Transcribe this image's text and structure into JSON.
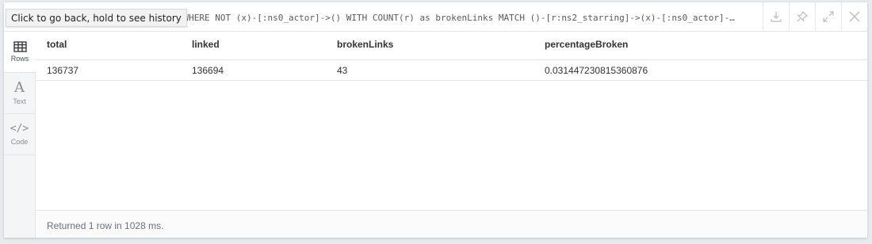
{
  "header": {
    "query": "(x) WHERE NOT (x)-[:ns0_actor]->() WITH COUNT(r) as brokenLinks MATCH ()-[r:ns2_starring]->(x)-[:ns0_actor]-…",
    "tooltip": "Click to go back, hold to see history",
    "actions": [
      {
        "icon": "download-icon"
      },
      {
        "icon": "pin-icon"
      },
      {
        "icon": "expand-icon"
      },
      {
        "icon": "close-icon"
      }
    ]
  },
  "sidebar": {
    "items": [
      {
        "label": "Rows",
        "icon": "table-icon",
        "active": true
      },
      {
        "label": "Text",
        "icon": "text-icon",
        "active": false
      },
      {
        "label": "Code",
        "icon": "code-icon",
        "active": false
      }
    ]
  },
  "table": {
    "columns": [
      "total",
      "linked",
      "brokenLinks",
      "percentageBroken"
    ],
    "rows": [
      [
        "136737",
        "136694",
        "43",
        "0.031447230815360876"
      ]
    ]
  },
  "footer": {
    "status": "Returned 1 row in 1028 ms."
  },
  "colors": {
    "border": "#e3e5e8",
    "sidebar_bg": "#f4f5f7",
    "icon_gray": "#b0b3b8"
  }
}
